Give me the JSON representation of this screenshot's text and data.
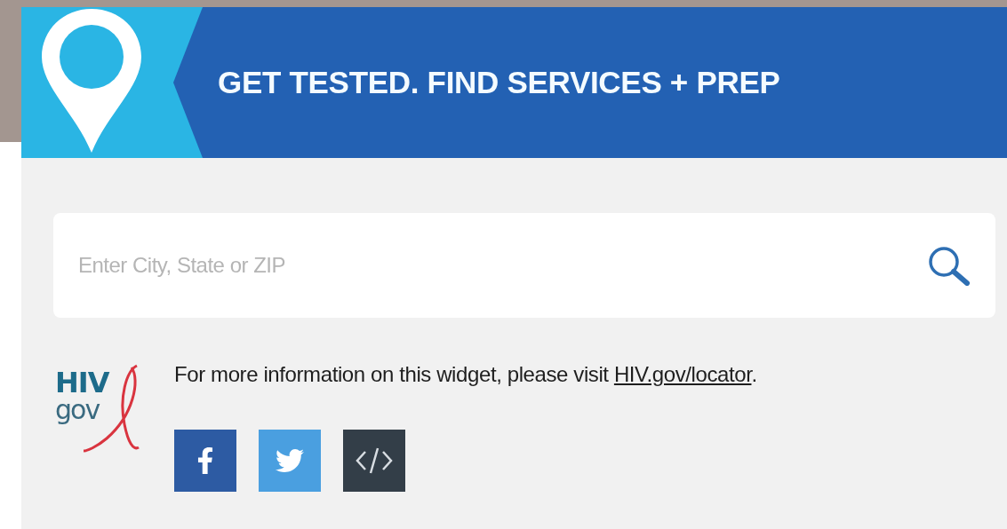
{
  "header": {
    "title": "GET TESTED. FIND SERVICES + PREP"
  },
  "search": {
    "placeholder": "Enter City, State or ZIP"
  },
  "logo": {
    "top": "HIV",
    "bottom": "gov"
  },
  "info": {
    "text_before": "For more information on this widget, please visit ",
    "link": "HIV.gov/locator",
    "text_after": "."
  },
  "share_buttons": [
    {
      "kind": "facebook",
      "color": "#2d5ba3"
    },
    {
      "kind": "twitter",
      "color": "#4a9fe0"
    },
    {
      "kind": "embed",
      "color": "#333e48"
    }
  ]
}
